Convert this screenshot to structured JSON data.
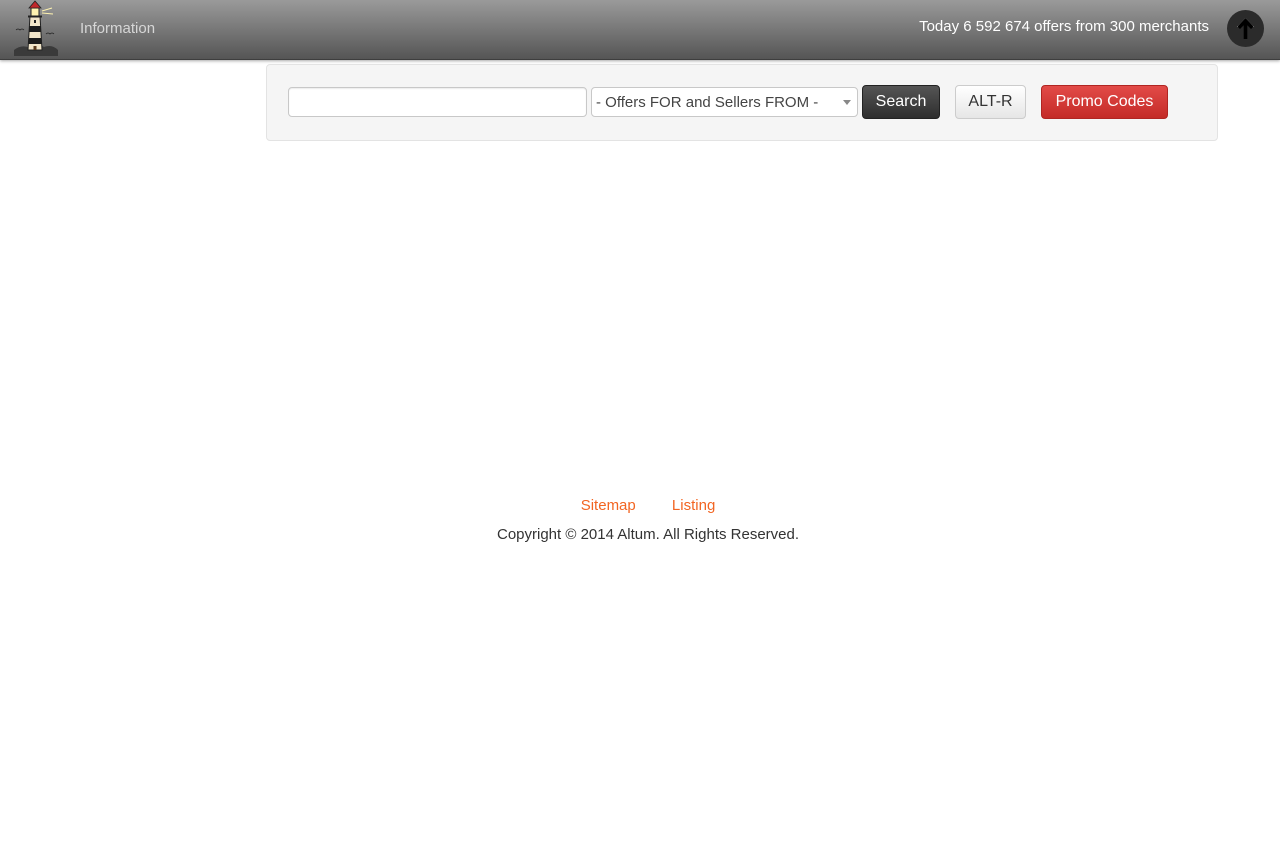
{
  "navbar": {
    "info_link": "Information",
    "stats_text": "Today 6 592 674 offers from 300 merchants",
    "logo_icon": "lighthouse-icon",
    "up_icon": "arrow-up-icon"
  },
  "search": {
    "query_value": "",
    "query_placeholder": "",
    "filter_selected": "- Offers FOR and Sellers FROM -",
    "search_label": "Search",
    "altr_label": "ALT-R",
    "promo_label": "Promo Codes"
  },
  "footer": {
    "links": [
      "Sitemap",
      "Listing"
    ],
    "copyright": "Copyright © 2014 Altum. All Rights Reserved."
  },
  "colors": {
    "link": "#f26522",
    "promo": "#d9534f",
    "navbar": "#6e6e6e"
  }
}
